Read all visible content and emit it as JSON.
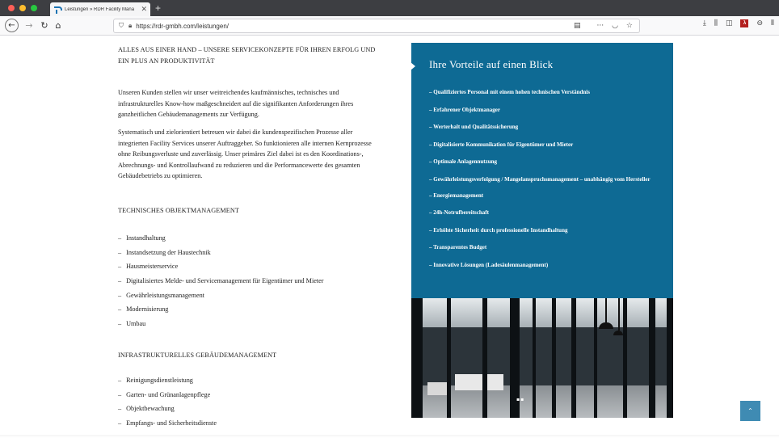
{
  "browser": {
    "tab_title": "Leistungen » RDR Facility Mana",
    "tab_close": "✕",
    "new_tab": "+",
    "url": "https://rdr-gmbh.com/leistungen/",
    "url_menu": "···",
    "icons": [
      "back-icon",
      "forward-icon",
      "reload-icon",
      "home-icon",
      "shield-icon",
      "lock-icon",
      "reader-icon",
      "pocket-icon",
      "bookmark-star-icon",
      "download-icon",
      "library-icon",
      "sidebar-icon",
      "pdf-icon",
      "account-icon",
      "menu-icon"
    ]
  },
  "main": {
    "intro_heading": "ALLES AUS EINER HAND – UNSERE SERVICEKONZEPTE FÜR IHREN ERFOLG UND EIN PLUS AN PRODUKTIVITÄT",
    "paragraph1": "Unseren Kunden stellen wir unser weitreichendes kaufmännisches, technisches und infrastrukturelles Know-how maßgeschneidert auf die signifikanten Anforderungen ihres ganzheitlichen Gebäudemanagements zur Verfügung.",
    "paragraph2": "Systematisch und zielorientiert betreuen wir dabei die kundenspezifischen Prozesse aller integrierten Facility Services unserer Auftraggeber. So funktionieren alle internen Kernprozesse ohne Reibungsverluste und zuverlässig. Unser primäres Ziel dabei ist es den Koordinations-, Abrechnungs- und Kontrollaufwand zu reduzieren und die Performancewerte des gesamten Gebäudebetriebs zu optimieren.",
    "section1_heading": "TECHNISCHES OBJEKTMANAGEMENT",
    "section1_items": [
      "Instandhaltung",
      "Instandsetzung der Haustechnik",
      "Hausmeisterservice",
      "Digitalisiertes Melde- und Servicemanagement für Eigentümer und Mieter",
      "Gewährleistungsmanagement",
      "Modernisierung",
      "Umbau"
    ],
    "section2_heading": "INFRASTRUKTURELLES GEBÄUDEMANAGEMENT",
    "section2_items": [
      "Reinigungsdienstleistung",
      "Garten- und Grünanlagenpflege",
      "Objektbewachung",
      "Empfangs- und Sicherheitsdienste"
    ]
  },
  "advantages": {
    "title": "Ihre Vorteile auf einen Blick",
    "items": [
      "Qualifiziertes Personal mit einem hohen technischen Verständnis",
      "Erfahrener Objektmanager",
      "Werterhalt und Qualitätssicherung",
      "Digitalisierte Kommunikation für Eigentümer und Mieter",
      "Optimale Anlagennutzung",
      "Gewährleistungsverfolgung / Mangelanspruchsmanagement – unabhängig vom Hersteller",
      "Energiemanagement",
      "24h-Notrufbereitschaft",
      "Erhöhte Sicherheit durch professionelle Instandhaltung",
      "Transparentes Budget",
      "Innovative Lösungen (Ladesäulenmanagement)"
    ]
  },
  "colors": {
    "accent_blue": "#0e6a94",
    "scroll_button": "#3f8bb3"
  }
}
